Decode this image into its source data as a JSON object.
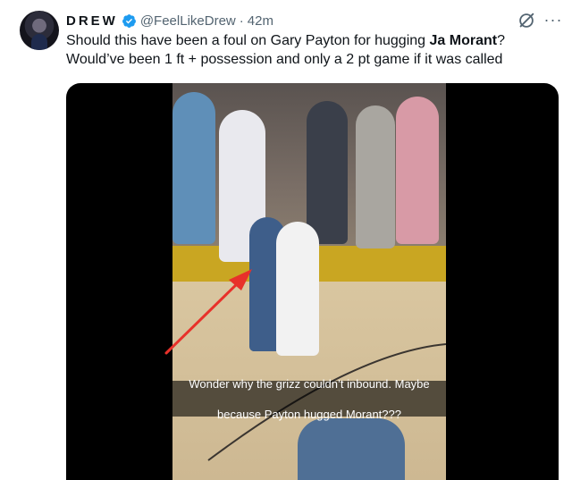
{
  "tweet": {
    "display_name": "DREW",
    "handle": "@FeelLikeDrew",
    "separator": "·",
    "time": "42m",
    "text_line1_prefix": "Should this have been a foul on Gary Payton for hugging ",
    "text_line1_bold": "Ja Morant",
    "text_line1_suffix": "?",
    "text_line2": "Would’ve been 1 ft + possession and only a 2 pt game if it was called"
  },
  "media": {
    "caption_line1": "Wonder why the grizz couldn’t inbound. Maybe",
    "caption_line2": "because Payton hugged Morant???"
  },
  "colors": {
    "verified_blue": "#1d9bf0",
    "arrow_red": "#e8312a",
    "secondary_text": "#536471"
  }
}
